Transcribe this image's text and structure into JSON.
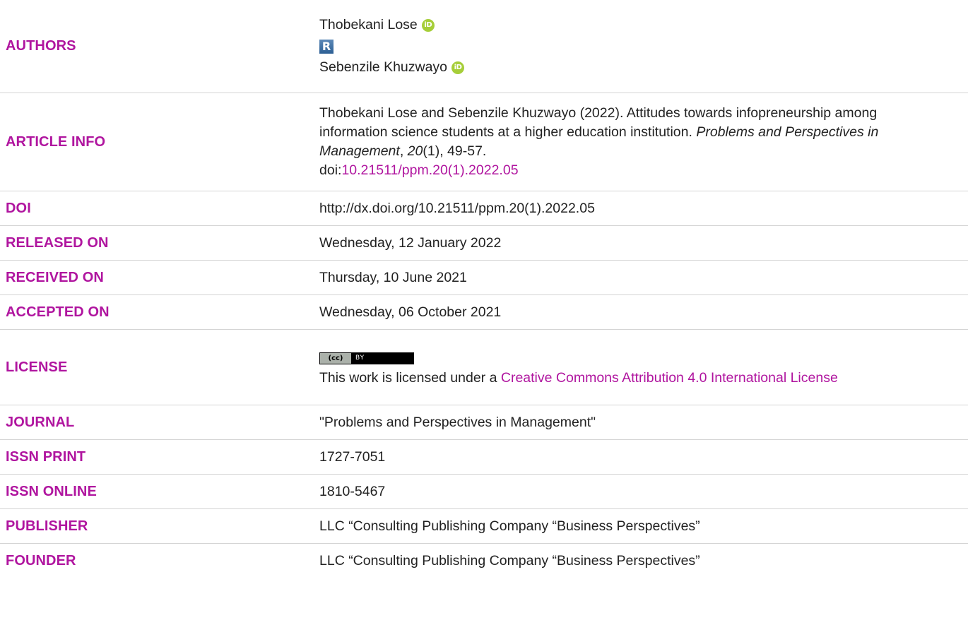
{
  "rows": {
    "authors": {
      "label": "AUTHORS",
      "names": [
        "Thobekani Lose",
        "Sebenzile Khuzwayo"
      ],
      "icons": [
        "orcid-icon",
        "researcherid-icon",
        "orcid-icon"
      ]
    },
    "article_info": {
      "label": "ARTICLE INFO",
      "citation_prefix": "Thobekani Lose and Sebenzile Khuzwayo (2022). Attitudes towards infopreneurship among information science students at a higher education institution. ",
      "journal_italic": "Problems and Perspectives in Management",
      "comma1": ", ",
      "volume_italic": "20",
      "issue_pages": "(1), 49-57.",
      "doi_prefix": "doi:",
      "doi_link": "10.21511/ppm.20(1).2022.05"
    },
    "doi": {
      "label": "DOI",
      "value": "http://dx.doi.org/10.21511/ppm.20(1).2022.05"
    },
    "released_on": {
      "label": "RELEASED ON",
      "value": "Wednesday, 12 January 2022"
    },
    "received_on": {
      "label": "RECEIVED ON",
      "value": "Thursday, 10 June 2021"
    },
    "accepted_on": {
      "label": "ACCEPTED ON",
      "value": "Wednesday, 06 October 2021"
    },
    "license": {
      "label": "LICENSE",
      "badge_left": "(cc)",
      "badge_right": "BY",
      "text_prefix": "This work is licensed under a ",
      "link_text": "Creative Commons Attribution 4.0 International License"
    },
    "journal": {
      "label": "JOURNAL",
      "value": "\"Problems and Perspectives in Management\""
    },
    "issn_print": {
      "label": "ISSN PRINT",
      "value": "1727-7051"
    },
    "issn_online": {
      "label": "ISSN ONLINE",
      "value": "1810-5467"
    },
    "publisher": {
      "label": "PUBLISHER",
      "value": "LLC “Consulting Publishing Company “Business Perspectives”"
    },
    "founder": {
      "label": "FOUNDER",
      "value": "LLC “Consulting Publishing Company “Business Perspectives”"
    }
  },
  "colors": {
    "label": "#b0159f",
    "link": "#b0159f",
    "orcid": "#a6ce39",
    "divider": "#d4d4d4"
  }
}
